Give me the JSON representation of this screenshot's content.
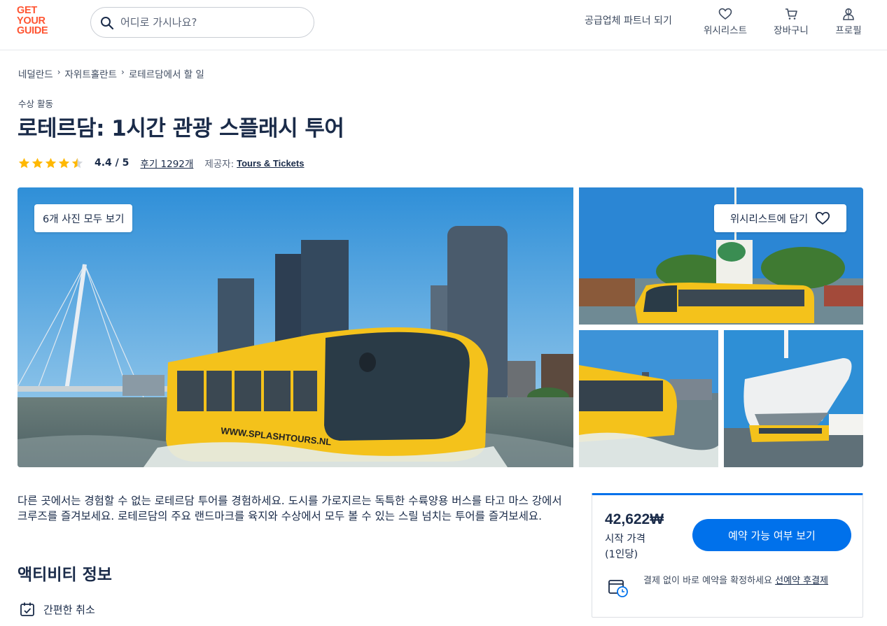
{
  "brand": {
    "logo_lines": [
      "GET",
      "YOUR",
      "GUIDE"
    ],
    "color": "#ff5533"
  },
  "search": {
    "placeholder": "어디로 가시나요?"
  },
  "header": {
    "partner_link": "공급업체 파트너 되기",
    "nav": [
      {
        "label": "위시리스트",
        "icon": "heart-icon"
      },
      {
        "label": "장바구니",
        "icon": "cart-icon"
      },
      {
        "label": "프로필",
        "icon": "profile-icon"
      }
    ]
  },
  "breadcrumb": [
    "네덜란드",
    "자위트홀란트",
    "로테르담에서 할 일"
  ],
  "activity": {
    "category": "수상 활동",
    "title": "로테르담: 1시간 관광 스플래시 투어",
    "rating": "4.4 / 5",
    "rating_value": 4.4,
    "reviews": "후기 1292개",
    "provider_label": "제공자:",
    "provider": "Tours & Tickets"
  },
  "gallery": {
    "all_photos_label": "6개 사진 모두 보기",
    "wishlist_label": "위시리스트에 담기",
    "bus_lettering": "WWW.SPLASHTOURS.NL"
  },
  "description": "다른 곳에서는 경험할 수 없는 로테르담 투어를 경험하세요. 도시를 가로지르는 독특한 수륙양용 버스를 타고 마스 강에서 크루즈를 즐겨보세요. 로테르담의 주요 랜드마크를 육지와 수상에서 모두 볼 수 있는 스릴 넘치는 투어를 즐겨보세요.",
  "info": {
    "section_title": "액티비티 정보",
    "features": [
      {
        "label": "간편한 취소",
        "icon": "calendar-check-icon"
      }
    ]
  },
  "booking": {
    "price": "42,622₩",
    "price_from": "시작 가격",
    "price_per": "(1인당)",
    "availability_button": "예약 가능 여부 보기",
    "reserve_text": "결제 없이 바로 예약을 확정하세요",
    "reserve_link": "선예약 후결제"
  },
  "colors": {
    "accent": "#0071eb",
    "text": "#1a2b49",
    "star": "#ffb800",
    "bus_yellow": "#f4c21b"
  }
}
